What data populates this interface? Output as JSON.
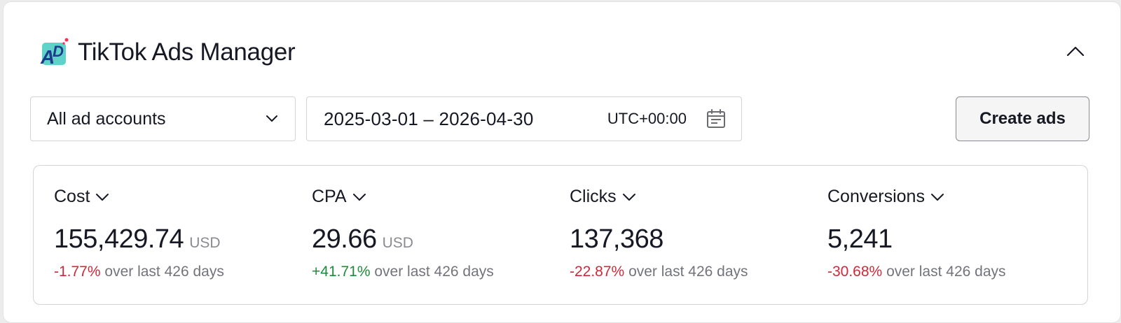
{
  "header": {
    "title": "TikTok Ads Manager",
    "logo_icon": "tiktok-ads-logo",
    "collapse_icon": "chevron-up-icon"
  },
  "filters": {
    "account_select": {
      "value": "All ad accounts",
      "icon": "chevron-down-icon"
    },
    "date_picker": {
      "range": "2025-03-01 – 2026-04-30",
      "timezone": "UTC+00:00",
      "icon": "calendar-icon"
    },
    "create_button_label": "Create ads"
  },
  "metrics": [
    {
      "label": "Cost",
      "value": "155,429.74",
      "unit": "USD",
      "change": "-1.77%",
      "change_trend": "negative",
      "period": "over last 426 days"
    },
    {
      "label": "CPA",
      "value": "29.66",
      "unit": "USD",
      "change": "+41.71%",
      "change_trend": "positive",
      "period": "over last 426 days"
    },
    {
      "label": "Clicks",
      "value": "137,368",
      "unit": "",
      "change": "-22.87%",
      "change_trend": "negative",
      "period": "over last 426 days"
    },
    {
      "label": "Conversions",
      "value": "5,241",
      "unit": "",
      "change": "-30.68%",
      "change_trend": "negative",
      "period": "over last 426 days"
    }
  ],
  "colors": {
    "negative": "#d0283a",
    "positive": "#1f8a3b",
    "logo_teal": "#5fd3c9",
    "logo_navy": "#1f3b8c",
    "logo_pink": "#fe2c55"
  }
}
